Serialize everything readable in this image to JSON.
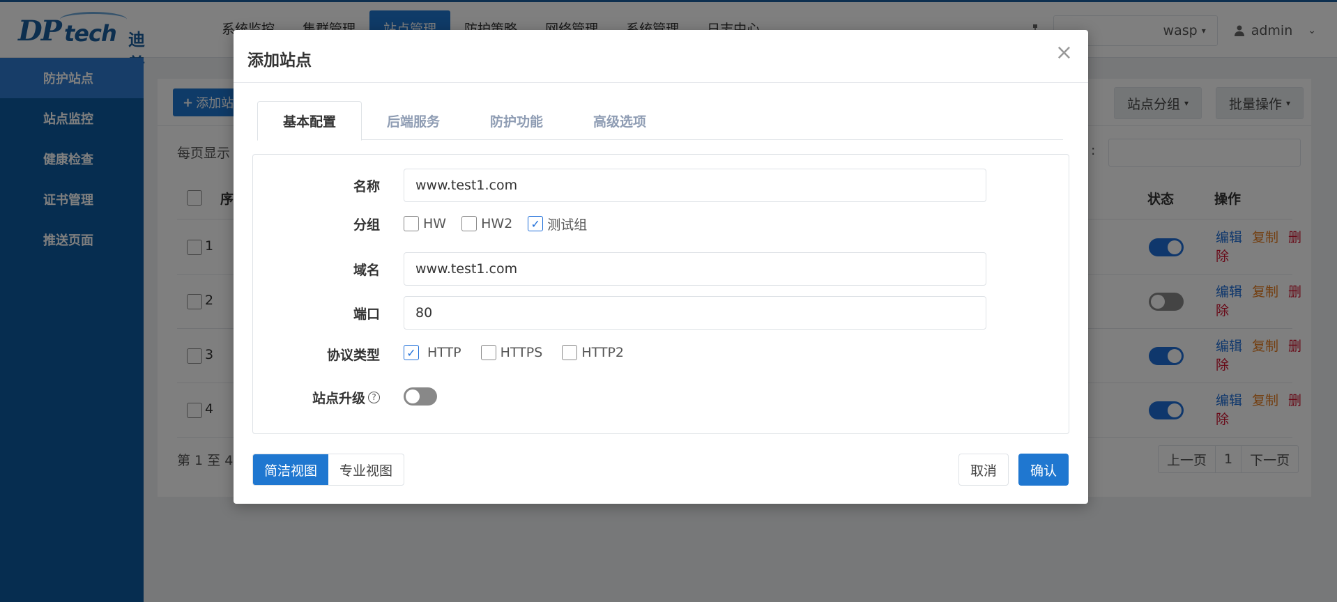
{
  "brand": {
    "logo_dp": "DP",
    "logo_tech": "tech",
    "logo_cn": "迪普"
  },
  "topnav": [
    "系统监控",
    "集群管理",
    "站点管理",
    "防护策略",
    "网络管理",
    "系统管理",
    "日志中心"
  ],
  "header": {
    "tenant": "wasp",
    "user": "admin"
  },
  "sidebar": [
    "防护站点",
    "站点监控",
    "健康检查",
    "证书管理",
    "推送页面"
  ],
  "toolbar": {
    "add": "添加站",
    "group": "站点分组",
    "batch": "批量操作"
  },
  "table": {
    "per_page": "每页显示",
    "search_label": ":",
    "headers": {
      "seq": "序",
      "status": "状态",
      "ops": "操作"
    },
    "rows": [
      {
        "num": "1",
        "enabled": true
      },
      {
        "num": "2",
        "enabled": false
      },
      {
        "num": "3",
        "enabled": true
      },
      {
        "num": "4",
        "enabled": true
      }
    ],
    "op_edit": "编辑",
    "op_copy": "复制",
    "op_delete": "删除",
    "footer": "第 1 至 4",
    "pager": {
      "prev": "上一页",
      "page": "1",
      "next": "下一页"
    }
  },
  "modal": {
    "title": "添加站点",
    "close": "×",
    "tabs": [
      "基本配置",
      "后端服务",
      "防护功能",
      "高级选项"
    ],
    "fields": {
      "name_label": "名称",
      "name_value": "www.test1.com",
      "group_label": "分组",
      "groups": [
        {
          "label": "HW",
          "checked": false
        },
        {
          "label": "HW2",
          "checked": false
        },
        {
          "label": "测试组",
          "checked": true
        }
      ],
      "domain_label": "域名",
      "domain_value": "www.test1.com",
      "port_label": "端口",
      "port_value": "80",
      "protocol_label": "协议类型",
      "protocols": [
        {
          "label": "HTTP",
          "checked": true
        },
        {
          "label": "HTTPS",
          "checked": false
        },
        {
          "label": "HTTP2",
          "checked": false
        }
      ],
      "upgrade_label": "站点升级",
      "upgrade_on": false
    },
    "views": [
      "简洁视图",
      "专业视图"
    ],
    "cancel": "取消",
    "confirm": "确认"
  },
  "colors": {
    "primary": "#1f77d0",
    "sidebar": "#0d5aa0",
    "copy": "#e67e22",
    "delete": "#d0102c"
  }
}
